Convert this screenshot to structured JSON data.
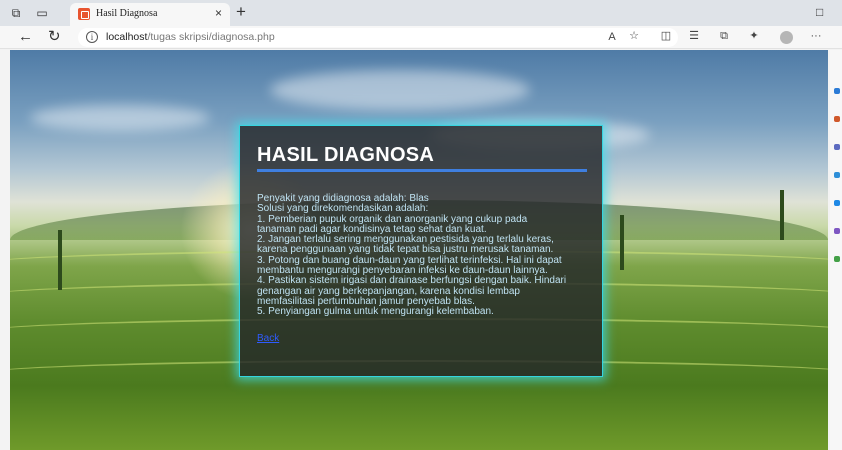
{
  "browser": {
    "tab": {
      "title": "Hasil Diagnosa",
      "close": "×"
    },
    "new_tab": "+",
    "window_icon": "□",
    "address": {
      "host": "localhost",
      "path": "/tugas skripsi/diagnosa.php"
    },
    "toolbar_icons": [
      "read-aloud-icon",
      "favorite-star-icon",
      "split-screen-icon",
      "favorites-list-icon",
      "collections-icon",
      "extensions-icon",
      "profile-avatar",
      "more-icon"
    ],
    "read_aloud_label": "A",
    "more_label": "···"
  },
  "card": {
    "title": "HASIL DIAGNOSA",
    "lines": [
      "Penyakit yang didiagnosa adalah: Blas",
      "Solusi yang direkomendasikan adalah:",
      "1. Pemberian pupuk organik dan anorganik yang cukup pada",
      "tanaman padi agar kondisinya tetap sehat dan kuat.",
      "2. Jangan terlalu sering menggunakan pestisida yang terlalu keras,",
      "karena penggunaan yang tidak tepat bisa justru merusak tanaman.",
      "3. Potong dan buang daun-daun yang terlihat terinfeksi. Hal ini dapat",
      "membantu mengurangi penyebaran infeksi ke daun-daun lainnya.",
      "4. Pastikan sistem irigasi dan drainase berfungsi dengan baik. Hindari",
      "genangan air yang berkepanjangan, karena kondisi lembap",
      "memfasilitasi pertumbuhan jamur penyebab blas.",
      "5. Penyiangan gulma untuk mengurangi kelembaban."
    ],
    "back_link": "Back"
  },
  "colors": {
    "accent_rule": "#3f7fe0",
    "card_glow": "#35d5e0",
    "body_text": "#bfe2f2",
    "link": "#2e5bff"
  }
}
